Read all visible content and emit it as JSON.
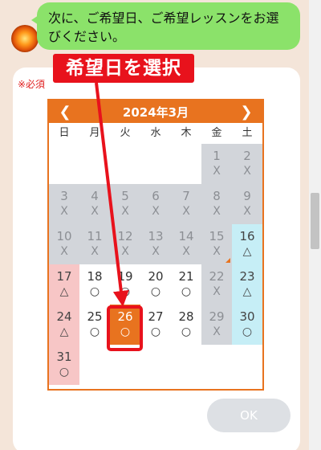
{
  "chat": {
    "message": "次に、ご希望日、ご希望レッスンをお選びください。"
  },
  "form": {
    "required_label": "※必須",
    "ok_label": "OK"
  },
  "calendar": {
    "title": "2024年3月",
    "prev": "❮",
    "next": "❯",
    "weekdays": [
      "日",
      "月",
      "火",
      "水",
      "木",
      "金",
      "土"
    ],
    "weeks": [
      [
        {
          "day": "",
          "mark": "",
          "state": "blank"
        },
        {
          "day": "",
          "mark": "",
          "state": "blank"
        },
        {
          "day": "",
          "mark": "",
          "state": "blank"
        },
        {
          "day": "",
          "mark": "",
          "state": "blank"
        },
        {
          "day": "",
          "mark": "",
          "state": "blank"
        },
        {
          "day": "1",
          "mark": "X",
          "state": "closed"
        },
        {
          "day": "2",
          "mark": "X",
          "state": "closed"
        }
      ],
      [
        {
          "day": "3",
          "mark": "X",
          "state": "closed"
        },
        {
          "day": "4",
          "mark": "X",
          "state": "closed"
        },
        {
          "day": "5",
          "mark": "X",
          "state": "closed"
        },
        {
          "day": "6",
          "mark": "X",
          "state": "closed"
        },
        {
          "day": "7",
          "mark": "X",
          "state": "closed"
        },
        {
          "day": "8",
          "mark": "X",
          "state": "closed"
        },
        {
          "day": "9",
          "mark": "X",
          "state": "closed"
        }
      ],
      [
        {
          "day": "10",
          "mark": "X",
          "state": "closed"
        },
        {
          "day": "11",
          "mark": "X",
          "state": "closed"
        },
        {
          "day": "12",
          "mark": "X",
          "state": "closed"
        },
        {
          "day": "13",
          "mark": "X",
          "state": "closed"
        },
        {
          "day": "14",
          "mark": "X",
          "state": "closed"
        },
        {
          "day": "15",
          "mark": "X",
          "state": "closed",
          "corner": true
        },
        {
          "day": "16",
          "mark": "△",
          "state": "sat"
        }
      ],
      [
        {
          "day": "17",
          "mark": "△",
          "state": "sun"
        },
        {
          "day": "18",
          "mark": "○",
          "state": "avail"
        },
        {
          "day": "19",
          "mark": "○",
          "state": "avail"
        },
        {
          "day": "20",
          "mark": "○",
          "state": "avail"
        },
        {
          "day": "21",
          "mark": "○",
          "state": "avail"
        },
        {
          "day": "22",
          "mark": "X",
          "state": "closed"
        },
        {
          "day": "23",
          "mark": "△",
          "state": "sat"
        }
      ],
      [
        {
          "day": "24",
          "mark": "△",
          "state": "sun"
        },
        {
          "day": "25",
          "mark": "○",
          "state": "avail"
        },
        {
          "day": "26",
          "mark": "○",
          "state": "selected"
        },
        {
          "day": "27",
          "mark": "○",
          "state": "avail"
        },
        {
          "day": "28",
          "mark": "○",
          "state": "avail"
        },
        {
          "day": "29",
          "mark": "X",
          "state": "closed"
        },
        {
          "day": "30",
          "mark": "○",
          "state": "sat"
        }
      ],
      [
        {
          "day": "31",
          "mark": "○",
          "state": "sun"
        },
        {
          "day": "",
          "mark": "",
          "state": "blank"
        },
        {
          "day": "",
          "mark": "",
          "state": "blank"
        },
        {
          "day": "",
          "mark": "",
          "state": "blank"
        },
        {
          "day": "",
          "mark": "",
          "state": "blank"
        },
        {
          "day": "",
          "mark": "",
          "state": "blank"
        },
        {
          "day": "",
          "mark": "",
          "state": "blank"
        }
      ]
    ]
  },
  "annotation": {
    "label": "希望日を選択",
    "color": "#e8121c"
  },
  "colors": {
    "accent": "#e8731f",
    "bubble": "#8be26a",
    "closed": "#d2d5da",
    "sunday": "#f7c6c6",
    "saturday": "#c6eef6"
  }
}
